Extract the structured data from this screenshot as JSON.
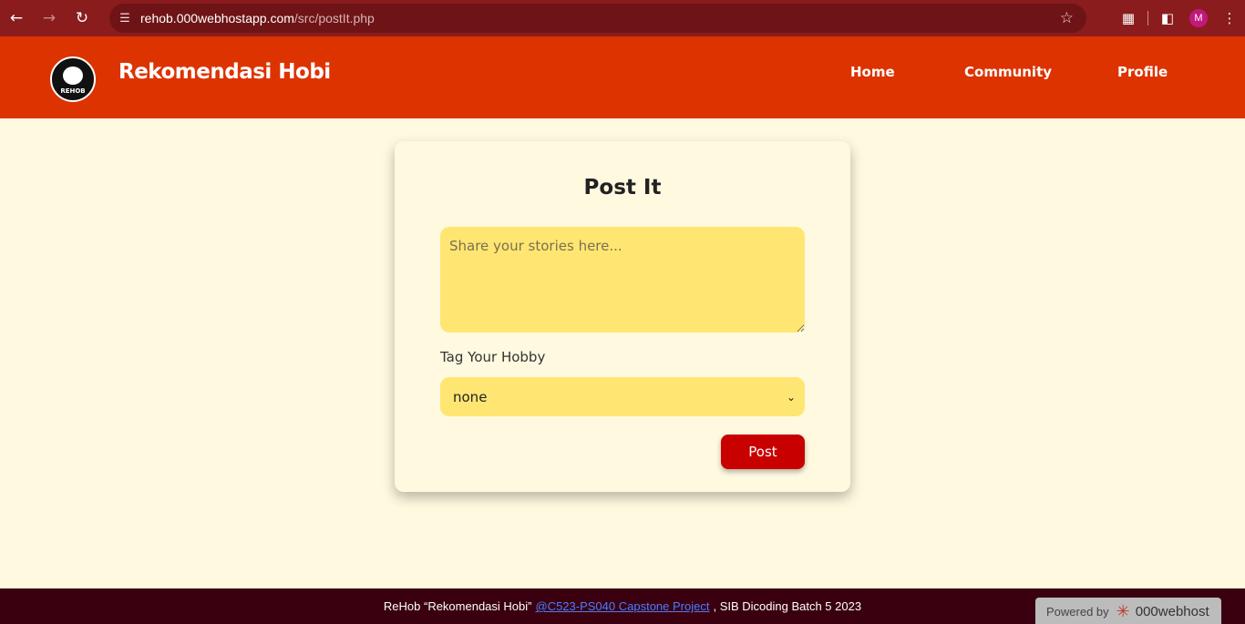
{
  "browser": {
    "url_host": "rehob.000webhostapp.com",
    "url_path": "/src/postIt.php",
    "profile_initial": "M"
  },
  "site": {
    "brand": "Rekomendasi Hobi",
    "logo_text": "REHOB",
    "nav": [
      "Home",
      "Community",
      "Profile"
    ]
  },
  "form": {
    "title": "Post It",
    "story_placeholder": "Share your stories here...",
    "tag_label": "Tag Your Hobby",
    "hobby_selected": "none",
    "post_label": "Post"
  },
  "footer": {
    "prefix": "ReHob “Rekomendasi Hobi”",
    "link": "@C523-PS040 Capstone Project",
    "suffix": ", SIB Dicoding Batch 5 2023",
    "powered_by": "Powered by",
    "host_brand": "000webhost"
  },
  "colors": {
    "header": "#dd3300",
    "chrome": "#8a1c1e",
    "page_bg": "#fff9e0",
    "input_bg": "#ffe672",
    "button": "#c80000",
    "footer": "#3a0010"
  },
  "icons": [
    "back-icon",
    "forward-icon",
    "reload-icon",
    "site-info-icon",
    "star-icon",
    "extensions-icon",
    "sidepanel-icon",
    "menu-dots-icon"
  ]
}
